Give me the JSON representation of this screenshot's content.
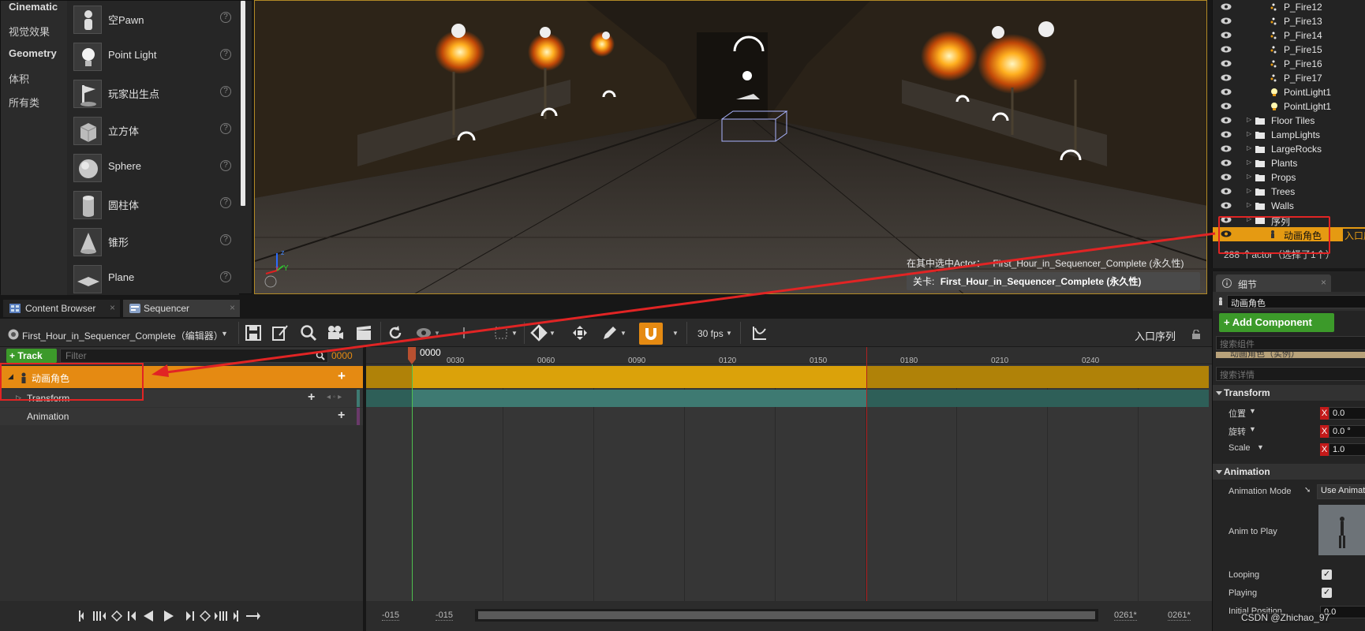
{
  "place_actors": {
    "categories": [
      "Cinematic",
      "视觉效果",
      "Geometry",
      "体积",
      "所有类"
    ],
    "items": [
      "空Pawn",
      "Point Light",
      "玩家出生点",
      "立方体",
      "Sphere",
      "圆柱体",
      "锥形",
      "Plane"
    ],
    "help": "?"
  },
  "viewport": {
    "selected_actor_label": "在其中选中Actor：",
    "selected_actor_value": "First_Hour_in_Sequencer_Complete (永久性)",
    "level_label": "关卡:",
    "level_value": "First_Hour_in_Sequencer_Complete (永久性)",
    "axis_x": "x",
    "axis_y": "Y",
    "axis_z": "z"
  },
  "outliner": {
    "rows": [
      {
        "label": "P_Fire12",
        "type": "actor"
      },
      {
        "label": "P_Fire13",
        "type": "actor"
      },
      {
        "label": "P_Fire14",
        "type": "actor"
      },
      {
        "label": "P_Fire15",
        "type": "actor"
      },
      {
        "label": "P_Fire16",
        "type": "actor"
      },
      {
        "label": "P_Fire17",
        "type": "actor"
      },
      {
        "label": "PointLight1",
        "type": "light"
      },
      {
        "label": "PointLight1",
        "type": "light"
      },
      {
        "label": "Floor Tiles",
        "type": "folder"
      },
      {
        "label": "LampLights",
        "type": "folder"
      },
      {
        "label": "LargeRocks",
        "type": "folder"
      },
      {
        "label": "Plants",
        "type": "folder"
      },
      {
        "label": "Props",
        "type": "folder"
      },
      {
        "label": "Trees",
        "type": "folder"
      },
      {
        "label": "Walls",
        "type": "folder"
      },
      {
        "label": "序列",
        "type": "folder"
      }
    ],
    "selected_label": "动画角色",
    "selected_type": "入口序",
    "footer": "288 个actor（选择了1个）"
  },
  "details": {
    "tab": "细节",
    "actor_name": "动画角色",
    "add_component": "+ Add Component",
    "search_components": "搜索组件",
    "component_row": "动画角色（实例）",
    "search_details": "搜索详情",
    "transform_section": "Transform",
    "location_label": "位置",
    "location_x": "0.0",
    "rotation_label": "旋转",
    "rotation_x": "0.0 °",
    "scale_label": "Scale",
    "scale_x": "1.0",
    "animation_section": "Animation",
    "animation_mode_label": "Animation Mode",
    "animation_mode_value": "Use Animation Asset",
    "anim_to_play_label": "Anim to Play",
    "looping_label": "Looping",
    "playing_label": "Playing",
    "initial_position_label": "Initial Position",
    "initial_position_value": "0.0",
    "x": "X",
    "check": "✓"
  },
  "tabs": {
    "content_browser": "Content Browser",
    "sequencer": "Sequencer"
  },
  "sequencer": {
    "sequence_name": "First_Hour_in_Sequencer_Complete（编辑器）",
    "fps": "30 fps",
    "entry_sequence": "入口序列",
    "track_button": "+ Track",
    "filter_placeholder": "Filter",
    "current_frame": "0000",
    "tracks": {
      "actor": "动画角色",
      "transform": "Transform",
      "animation": "Animation"
    },
    "plus": "+",
    "ticks": [
      "0030",
      "0060",
      "0090",
      "0120",
      "0150",
      "0180",
      "0210",
      "0240"
    ],
    "playhead_label": "0000",
    "footer": {
      "start_a": "-015",
      "start_b": "-015",
      "end_a": "0261*",
      "end_b": "0261*"
    }
  },
  "watermark": "CSDN @Zhichao_97",
  "colors": {
    "accent_orange": "#e59a12",
    "track_gold": "#dba20a",
    "transform_teal": "#3e7a72",
    "annotation_red": "#e12424",
    "add_component_green": "#3c9a2a"
  }
}
